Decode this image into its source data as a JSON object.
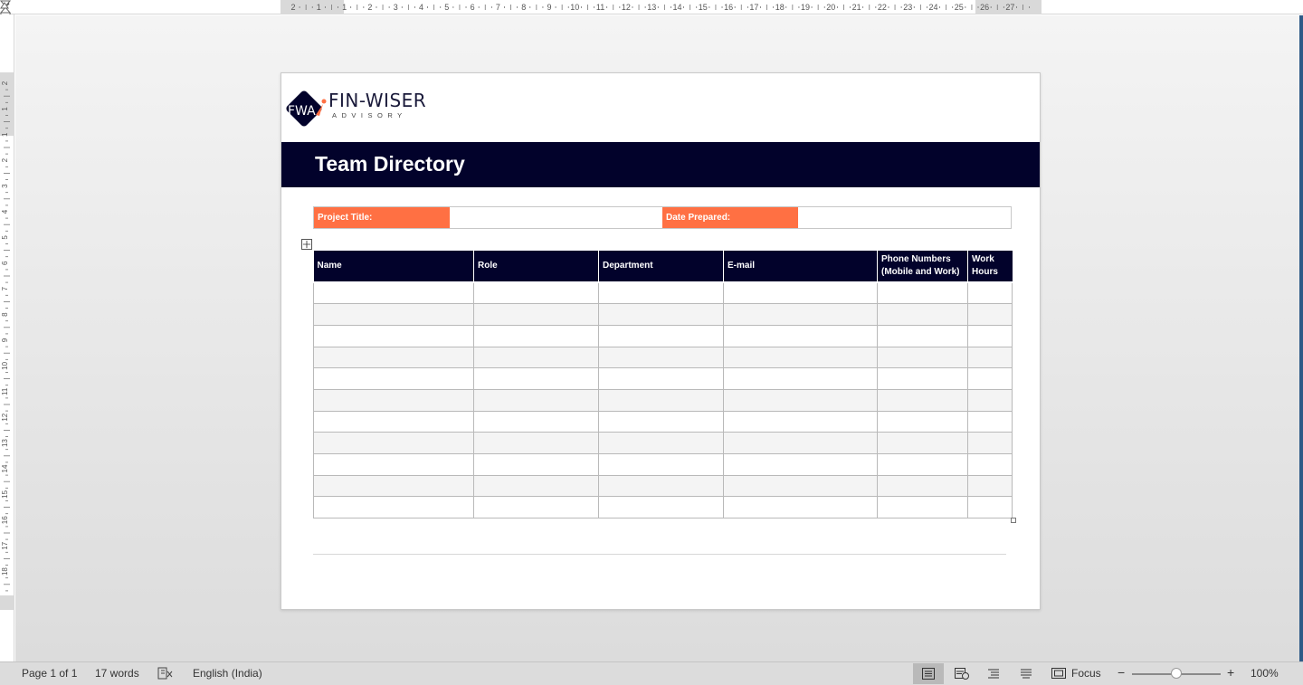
{
  "ruler": {
    "corner_glyph": "↱",
    "h_labels": [
      "2",
      "1",
      "1",
      "2",
      "3",
      "4",
      "5",
      "6",
      "7",
      "8",
      "9",
      "10",
      "11",
      "12",
      "13",
      "14",
      "15",
      "16",
      "17",
      "18",
      "19",
      "20",
      "21",
      "22",
      "23",
      "24",
      "25",
      "26",
      "27"
    ],
    "v_labels": [
      "2",
      "1",
      "1",
      "2",
      "3",
      "4",
      "5",
      "6",
      "7",
      "8",
      "9",
      "10",
      "11",
      "12",
      "13",
      "14",
      "15",
      "16",
      "17",
      "18"
    ]
  },
  "document": {
    "logo": {
      "mark": "FWA",
      "name": "FIN-WISER",
      "tagline": "ADVISORY"
    },
    "title": "Team Directory",
    "info": {
      "project_title_label": "Project Title:",
      "project_title_value": "",
      "date_prepared_label": "Date Prepared:",
      "date_prepared_value": ""
    },
    "table": {
      "headers": [
        "Name",
        "Role",
        "Department",
        "E-mail",
        "Phone Numbers (Mobile and Work)",
        "Work Hours"
      ],
      "row_count": 11
    }
  },
  "statusbar": {
    "page": "Page 1 of 1",
    "words": "17 words",
    "language": "English (India)",
    "focus": "Focus",
    "zoom_minus": "−",
    "zoom_plus": "+",
    "zoom": "100%",
    "zoom_percent": 50
  },
  "colors": {
    "banner": "#02022b",
    "accent": "#ff7043"
  }
}
